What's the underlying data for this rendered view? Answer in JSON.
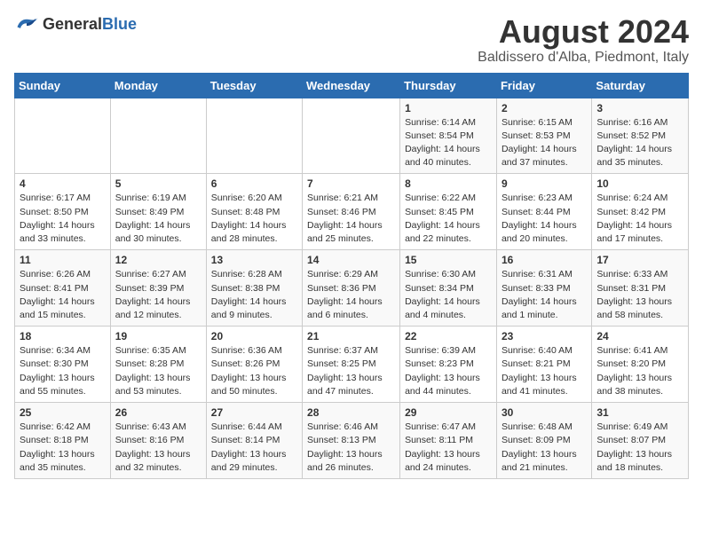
{
  "logo": {
    "general": "General",
    "blue": "Blue"
  },
  "title": "August 2024",
  "subtitle": "Baldissero d'Alba, Piedmont, Italy",
  "days_of_week": [
    "Sunday",
    "Monday",
    "Tuesday",
    "Wednesday",
    "Thursday",
    "Friday",
    "Saturday"
  ],
  "weeks": [
    [
      {
        "day": "",
        "info": ""
      },
      {
        "day": "",
        "info": ""
      },
      {
        "day": "",
        "info": ""
      },
      {
        "day": "",
        "info": ""
      },
      {
        "day": "1",
        "info": "Sunrise: 6:14 AM\nSunset: 8:54 PM\nDaylight: 14 hours and 40 minutes."
      },
      {
        "day": "2",
        "info": "Sunrise: 6:15 AM\nSunset: 8:53 PM\nDaylight: 14 hours and 37 minutes."
      },
      {
        "day": "3",
        "info": "Sunrise: 6:16 AM\nSunset: 8:52 PM\nDaylight: 14 hours and 35 minutes."
      }
    ],
    [
      {
        "day": "4",
        "info": "Sunrise: 6:17 AM\nSunset: 8:50 PM\nDaylight: 14 hours and 33 minutes."
      },
      {
        "day": "5",
        "info": "Sunrise: 6:19 AM\nSunset: 8:49 PM\nDaylight: 14 hours and 30 minutes."
      },
      {
        "day": "6",
        "info": "Sunrise: 6:20 AM\nSunset: 8:48 PM\nDaylight: 14 hours and 28 minutes."
      },
      {
        "day": "7",
        "info": "Sunrise: 6:21 AM\nSunset: 8:46 PM\nDaylight: 14 hours and 25 minutes."
      },
      {
        "day": "8",
        "info": "Sunrise: 6:22 AM\nSunset: 8:45 PM\nDaylight: 14 hours and 22 minutes."
      },
      {
        "day": "9",
        "info": "Sunrise: 6:23 AM\nSunset: 8:44 PM\nDaylight: 14 hours and 20 minutes."
      },
      {
        "day": "10",
        "info": "Sunrise: 6:24 AM\nSunset: 8:42 PM\nDaylight: 14 hours and 17 minutes."
      }
    ],
    [
      {
        "day": "11",
        "info": "Sunrise: 6:26 AM\nSunset: 8:41 PM\nDaylight: 14 hours and 15 minutes."
      },
      {
        "day": "12",
        "info": "Sunrise: 6:27 AM\nSunset: 8:39 PM\nDaylight: 14 hours and 12 minutes."
      },
      {
        "day": "13",
        "info": "Sunrise: 6:28 AM\nSunset: 8:38 PM\nDaylight: 14 hours and 9 minutes."
      },
      {
        "day": "14",
        "info": "Sunrise: 6:29 AM\nSunset: 8:36 PM\nDaylight: 14 hours and 6 minutes."
      },
      {
        "day": "15",
        "info": "Sunrise: 6:30 AM\nSunset: 8:34 PM\nDaylight: 14 hours and 4 minutes."
      },
      {
        "day": "16",
        "info": "Sunrise: 6:31 AM\nSunset: 8:33 PM\nDaylight: 14 hours and 1 minute."
      },
      {
        "day": "17",
        "info": "Sunrise: 6:33 AM\nSunset: 8:31 PM\nDaylight: 13 hours and 58 minutes."
      }
    ],
    [
      {
        "day": "18",
        "info": "Sunrise: 6:34 AM\nSunset: 8:30 PM\nDaylight: 13 hours and 55 minutes."
      },
      {
        "day": "19",
        "info": "Sunrise: 6:35 AM\nSunset: 8:28 PM\nDaylight: 13 hours and 53 minutes."
      },
      {
        "day": "20",
        "info": "Sunrise: 6:36 AM\nSunset: 8:26 PM\nDaylight: 13 hours and 50 minutes."
      },
      {
        "day": "21",
        "info": "Sunrise: 6:37 AM\nSunset: 8:25 PM\nDaylight: 13 hours and 47 minutes."
      },
      {
        "day": "22",
        "info": "Sunrise: 6:39 AM\nSunset: 8:23 PM\nDaylight: 13 hours and 44 minutes."
      },
      {
        "day": "23",
        "info": "Sunrise: 6:40 AM\nSunset: 8:21 PM\nDaylight: 13 hours and 41 minutes."
      },
      {
        "day": "24",
        "info": "Sunrise: 6:41 AM\nSunset: 8:20 PM\nDaylight: 13 hours and 38 minutes."
      }
    ],
    [
      {
        "day": "25",
        "info": "Sunrise: 6:42 AM\nSunset: 8:18 PM\nDaylight: 13 hours and 35 minutes."
      },
      {
        "day": "26",
        "info": "Sunrise: 6:43 AM\nSunset: 8:16 PM\nDaylight: 13 hours and 32 minutes."
      },
      {
        "day": "27",
        "info": "Sunrise: 6:44 AM\nSunset: 8:14 PM\nDaylight: 13 hours and 29 minutes."
      },
      {
        "day": "28",
        "info": "Sunrise: 6:46 AM\nSunset: 8:13 PM\nDaylight: 13 hours and 26 minutes."
      },
      {
        "day": "29",
        "info": "Sunrise: 6:47 AM\nSunset: 8:11 PM\nDaylight: 13 hours and 24 minutes."
      },
      {
        "day": "30",
        "info": "Sunrise: 6:48 AM\nSunset: 8:09 PM\nDaylight: 13 hours and 21 minutes."
      },
      {
        "day": "31",
        "info": "Sunrise: 6:49 AM\nSunset: 8:07 PM\nDaylight: 13 hours and 18 minutes."
      }
    ]
  ]
}
